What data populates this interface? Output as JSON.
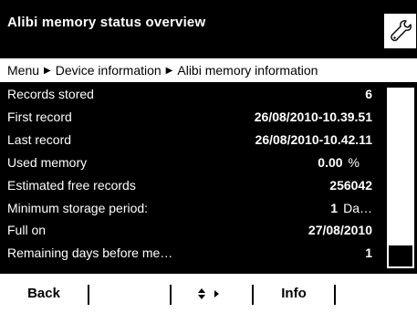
{
  "header": {
    "title": "Alibi memory status overview",
    "tool_icon": "wrench-icon"
  },
  "breadcrumb": {
    "items": [
      "Menu",
      "Device information",
      "Alibi memory information"
    ],
    "separator_icon": "triangle-right-icon"
  },
  "rows": [
    {
      "label": "Records stored",
      "value": "6",
      "unit": ""
    },
    {
      "label": "First record",
      "value": "26/08/2010-10.39.51",
      "unit": ""
    },
    {
      "label": "Last record",
      "value": "26/08/2010-10.42.11",
      "unit": ""
    },
    {
      "label": "Used memory",
      "value": "0.00",
      "unit": "%"
    },
    {
      "label": "Estimated free records",
      "value": "256042",
      "unit": ""
    },
    {
      "label": "Minimum storage period:",
      "value": "1",
      "unit": "Da…"
    },
    {
      "label": "Full on",
      "value": "27/08/2010",
      "unit": ""
    },
    {
      "label": "Remaining days before me…",
      "value": "1",
      "unit": ""
    }
  ],
  "scroll": {
    "position_fraction": 0.88,
    "visible_fraction": 0.12
  },
  "footer": {
    "back_label": "Back",
    "nav_icon": "up-down-right-arrows-icon",
    "info_label": "Info"
  },
  "colors": {
    "background": "#000000",
    "foreground": "#ffffff"
  }
}
